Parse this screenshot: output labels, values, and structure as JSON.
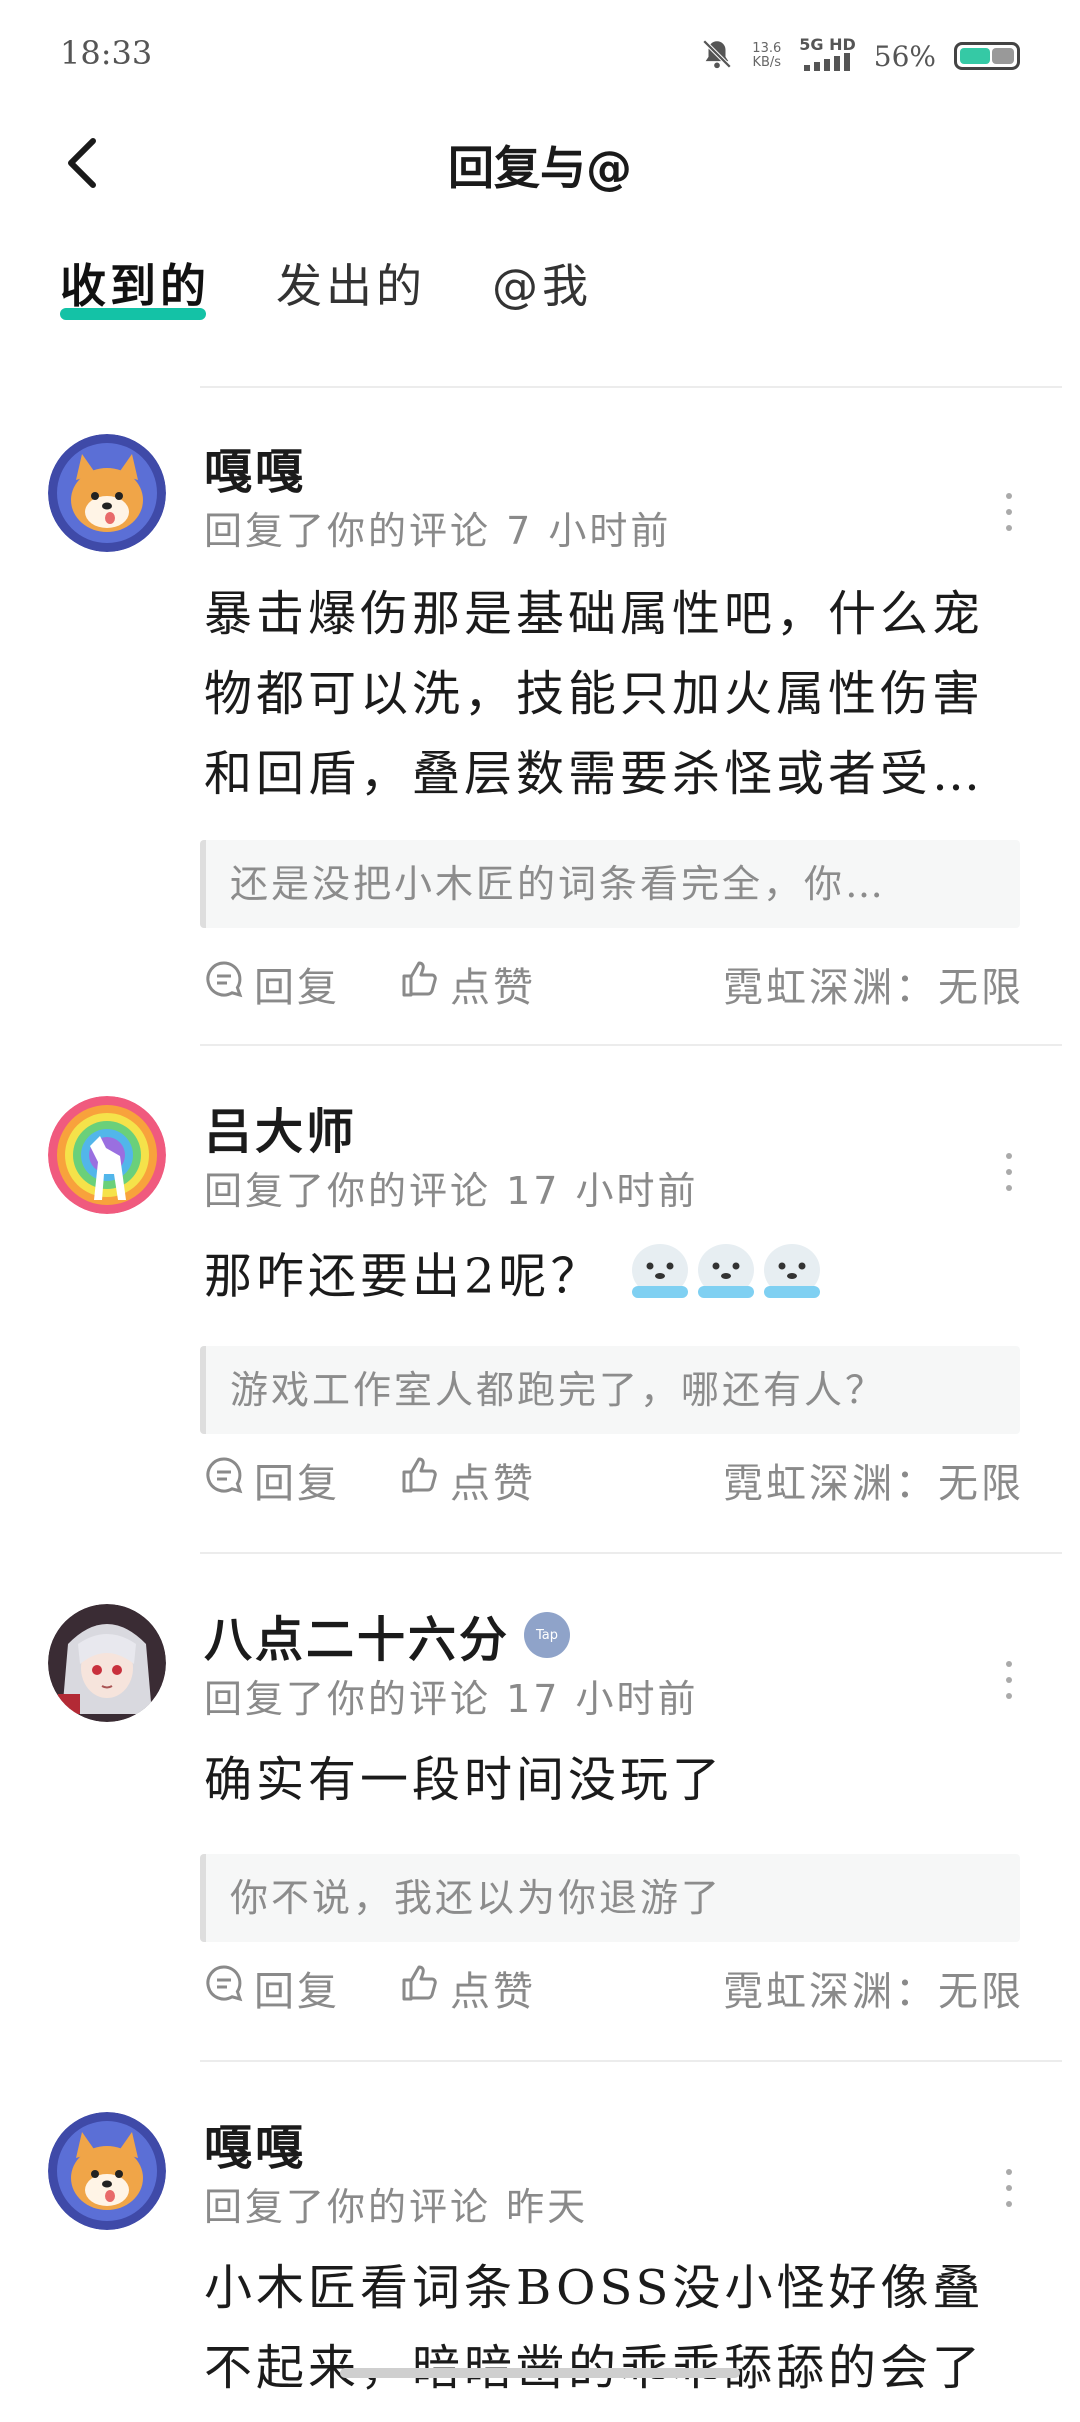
{
  "status_bar": {
    "time": "18:33",
    "speed_value": "13.6",
    "speed_unit": "KB/s",
    "network": "5G HD",
    "battery": "56%",
    "battery_level": 0.56,
    "icons": [
      "bell-muted-icon",
      "signal-icon",
      "battery-icon"
    ]
  },
  "header": {
    "title": "回复与@",
    "back_icon": "chevron-left-icon"
  },
  "tabs": [
    {
      "label": "收到的",
      "active": true
    },
    {
      "label": "发出的",
      "active": false
    },
    {
      "label": "@我",
      "active": false
    }
  ],
  "accent_color": "#14c2a6",
  "items": [
    {
      "username": "嘎嘎",
      "meta": "回复了你的评论 7 小时前",
      "content": "暴击爆伤那是基础属性吧，什么宠物都可以洗，技能只加火属性伤害和回盾，叠层数需要杀怪或者受…",
      "quote": "还是没把小木匠的词条看完全，你…",
      "reply_label": "回复",
      "like_label": "点赞",
      "game_tag": "霓虹深渊：无限"
    },
    {
      "username": "吕大师",
      "meta": "回复了你的评论 17 小时前",
      "content": "那咋还要出2呢？",
      "quote": "游戏工作室人都跑完了，哪还有人？",
      "reply_label": "回复",
      "like_label": "点赞",
      "game_tag": "霓虹深渊：无限"
    },
    {
      "username": "八点二十六分",
      "badge": "Tap",
      "meta": "回复了你的评论 17 小时前",
      "content": "确实有一段时间没玩了",
      "quote": "你不说，我还以为你退游了",
      "reply_label": "回复",
      "like_label": "点赞",
      "game_tag": "霓虹深渊：无限"
    },
    {
      "username": "嘎嘎",
      "meta": "回复了你的评论 昨天",
      "content": "小木匠看词条BOSS没小怪好像叠不起来，暗暗凿的乖乖舔舔的会了"
    }
  ]
}
